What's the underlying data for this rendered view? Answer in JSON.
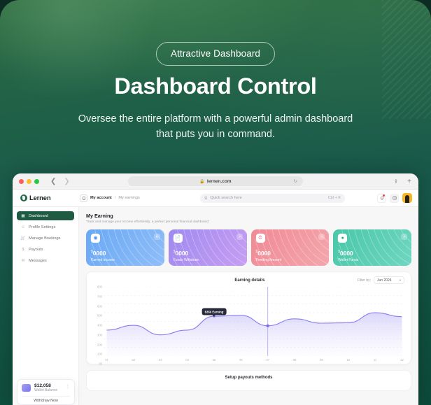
{
  "hero": {
    "badge": "Attractive Dashboard",
    "title": "Dashboard Control",
    "subtitle": "Oversee the entire platform with a powerful admin dashboard that puts you in command.",
    "bg_color": "#16533f",
    "accent": "#2d6b3f"
  },
  "browser": {
    "url": "lernen.com",
    "lock_icon": "lock-icon",
    "reload_icon": "reload-icon",
    "back_icon": "chevron-left-icon",
    "forward_icon": "chevron-right-icon",
    "share_icon": "share-icon",
    "new_tab_icon": "plus-icon"
  },
  "app": {
    "logo_text": "Lernen",
    "breadcrumb": {
      "parent": "My account",
      "separator": "/",
      "current": "My earnings"
    },
    "search": {
      "placeholder": "Quick search here",
      "shortcut": "Ctrl + K",
      "icon": "search-icon"
    },
    "header_icons": {
      "notification": "bell-icon",
      "panel": "layout-icon",
      "avatar": "avatar"
    }
  },
  "sidebar": {
    "items": [
      {
        "label": "Dashboard",
        "icon": "grid-icon",
        "active": true
      },
      {
        "label": "Profile Settings",
        "icon": "user-icon",
        "active": false
      },
      {
        "label": "Manage Bookings",
        "icon": "cart-icon",
        "active": false
      },
      {
        "label": "Payouts",
        "icon": "dollar-icon",
        "active": false
      },
      {
        "label": "Messages",
        "icon": "message-icon",
        "active": false
      }
    ],
    "wallet": {
      "amount": "$12,058",
      "label": "Wallet Balance",
      "button": "Withdraw Now",
      "more_icon": "more-icon"
    }
  },
  "main": {
    "title": "My Earning",
    "subtitle": "Track and manage your income effortlessly, a perfect personal financial dashboard.",
    "stats": [
      {
        "amount": "0000",
        "currency": "$",
        "label": "Earned Income",
        "icon": "coin-icon",
        "corner_icon": "refresh-icon",
        "color_from": "#6aa9f5",
        "color_to": "#8fbdf8"
      },
      {
        "amount": "0000",
        "currency": "$",
        "label": "Funds Withdraw",
        "icon": "receipt-icon",
        "corner_icon": "external-link-icon",
        "color_from": "#9f8af0",
        "color_to": "#c79ef2"
      },
      {
        "amount": "0000",
        "currency": "$",
        "label": "Pending Amount",
        "icon": "clock-icon",
        "corner_icon": "bell-icon",
        "color_from": "#f08a95",
        "color_to": "#f3a6ac"
      },
      {
        "amount": "0000",
        "currency": "$",
        "label": "Wallet Funds",
        "icon": "wallet-icon",
        "corner_icon": "external-link-icon",
        "color_from": "#49c7a8",
        "color_to": "#6fd6c0"
      }
    ],
    "payouts_title": "Setup payouts methods"
  },
  "chart_data": {
    "type": "area",
    "title": "Earning details",
    "filter_label": "Filter by:",
    "filter_value": "Jun 2024",
    "xlabel": "",
    "ylabel": "",
    "categories": [
      "01",
      "02",
      "03",
      "04",
      "05",
      "06",
      "07",
      "08",
      "09",
      "10",
      "11",
      "12"
    ],
    "values": [
      300,
      355,
      245,
      300,
      460,
      470,
      350,
      430,
      380,
      385,
      500,
      455
    ],
    "ylim": [
      0,
      800
    ],
    "yticks": [
      "800",
      "700",
      "600",
      "500",
      "400",
      "300",
      "200",
      "100",
      "00"
    ],
    "grid": true,
    "legend": "none",
    "series_color": "#8b7df0",
    "annotation": {
      "text": "$350 Earning",
      "x_index": 4,
      "value": 460
    },
    "marker": {
      "x_index": 6,
      "value": 350
    }
  }
}
